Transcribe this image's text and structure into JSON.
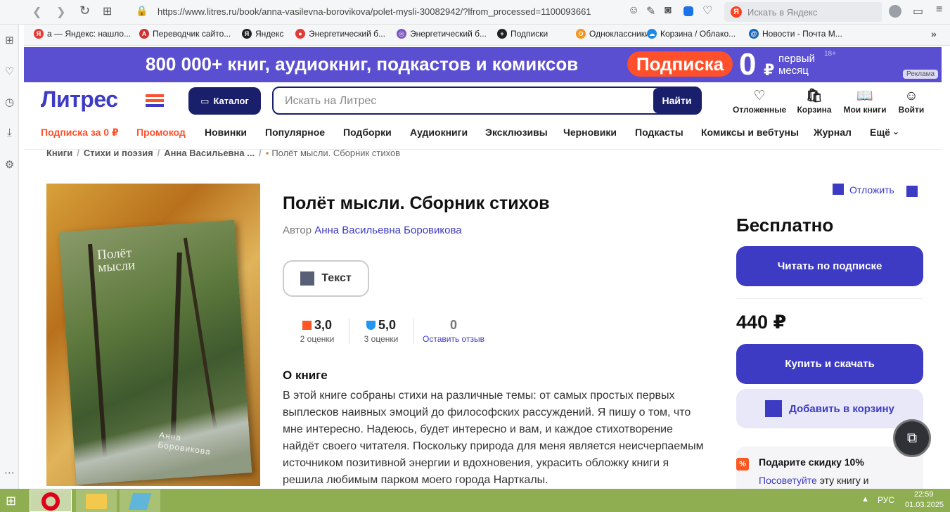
{
  "browser": {
    "url": "https://www.litres.ru/book/anna-vasilevna-borovikova/polet-mysli-30082942/?lfrom_processed=1100093661",
    "search_placeholder": "Искать в Яндекс",
    "bookmarks": [
      {
        "label": "а — Яндекс: нашло...",
        "color": "#e53935",
        "glyph": "Я"
      },
      {
        "label": "Переводчик сайто...",
        "color": "#d32f2f",
        "glyph": "A"
      },
      {
        "label": "Яндекс",
        "color": "#222222",
        "glyph": "Я"
      },
      {
        "label": "Энергетический б...",
        "color": "#e53935",
        "glyph": "●"
      },
      {
        "label": "Энергетический б...",
        "color": "#7e57c2",
        "glyph": "◎"
      },
      {
        "label": "Подписки",
        "color": "#222222",
        "glyph": "+"
      },
      {
        "label": "Одноклассники",
        "color": "#f7931e",
        "glyph": "О"
      },
      {
        "label": "Корзина / Облако...",
        "color": "#1e88e5",
        "glyph": "☁"
      },
      {
        "label": "Новости - Почта М...",
        "color": "#1565c0",
        "glyph": "@"
      }
    ],
    "more": "»"
  },
  "banner": {
    "main": "800 000+ книг, аудиокниг, подкастов и комиксов",
    "badge": "Подписка",
    "zero": "0",
    "currency": "₽",
    "first": "первый",
    "month": "месяц",
    "age": "18+",
    "ad": "Реклама"
  },
  "header": {
    "logo": "Литрес",
    "catalog": "Каталог",
    "search_placeholder": "Искать на Литрес",
    "search_button": "Найти",
    "icons": [
      {
        "label": "Отложенные",
        "glyph": "♡"
      },
      {
        "label": "Корзина",
        "glyph": "🛍"
      },
      {
        "label": "Мои книги",
        "glyph": "📖"
      },
      {
        "label": "Войти",
        "glyph": "☺"
      }
    ],
    "nav": [
      "Подписка за 0 ₽",
      "Промокод",
      "Новинки",
      "Популярное",
      "Подборки",
      "Аудиокниги",
      "Эксклюзивы",
      "Черновики",
      "Подкасты",
      "Комиксы и вебтуны",
      "Журнал",
      "Ещё"
    ]
  },
  "breadcrumb": [
    "Книги",
    "Стихи и поэзия",
    "Анна Васильевна ...",
    "Полёт мысли. Сборник стихов"
  ],
  "book": {
    "title": "Полёт мысли. Сборник стихов",
    "author_prefix": "Автор",
    "author": "Анна Васильевна Боровикова",
    "format": "Текст",
    "cover_title": "Полёт\nмысли",
    "cover_author": "Анна\nБоровикова",
    "ratings": [
      {
        "value": "3,0",
        "sub": "2 оценки",
        "color": "#ff5722"
      },
      {
        "value": "5,0",
        "sub": "3 оценки",
        "color": "#2196f3"
      },
      {
        "value": "0",
        "sub": "Оставить отзыв",
        "color": ""
      }
    ],
    "about_title": "О книге",
    "about": "В этой книге собраны стихи на различные темы: от самых простых первых выплесков наивных эмоций до философских рассуждений. Я пишу о том, что мне интересно. Надеюсь, будет интересно и вам, и каждое стихотворение найдёт своего читателя. Поскольку природа для меня является неисчерпаемым источником позитивной энергии и вдохновения, украсить обложку книги я решила любимым парком моего города Нарткалы."
  },
  "purchase": {
    "defer": "Отложить",
    "free": "Бесплатно",
    "read_sub": "Читать по подписке",
    "price": "440 ₽",
    "buy": "Купить и скачать",
    "cart": "Добавить в корзину",
    "promo_title": "Подарите скидку 10%",
    "promo_link": "Посоветуйте",
    "promo_text": "эту книгу и"
  },
  "taskbar": {
    "lang": "РУС",
    "time": "22:59",
    "date": "01.03.2025"
  }
}
